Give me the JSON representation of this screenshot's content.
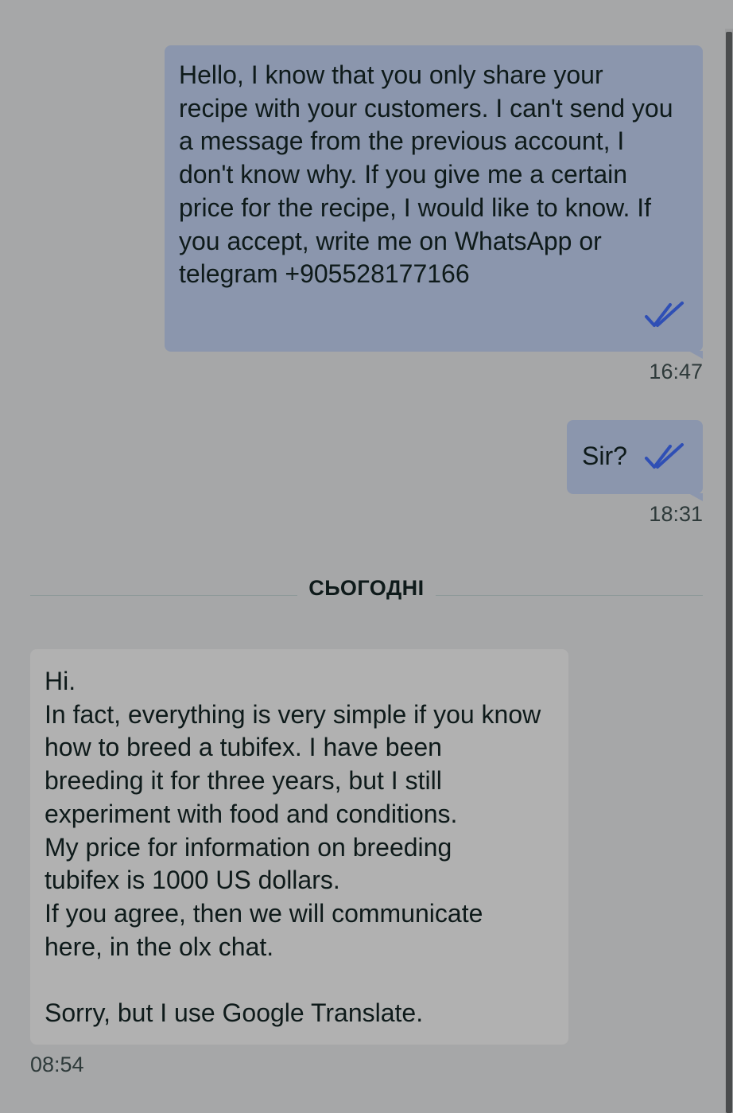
{
  "messages": [
    {
      "direction": "outgoing",
      "text": "Hello, I know that you only share your\nrecipe with your customers. I can't send you\na message from the previous account, I\ndon't know why. If you give me a certain\nprice for the recipe, I would like to know. If\nyou accept, write me on WhatsApp or\ntelegram +905528177166",
      "time": "16:47",
      "status_icon": "double-check-read"
    },
    {
      "direction": "outgoing",
      "text": "Sir?",
      "time": "18:31",
      "status_icon": "double-check-read"
    },
    {
      "direction": "incoming",
      "text": "Hi.\nIn fact, everything is very simple if you know\nhow to breed a tubifex. I have been\nbreeding it for three years, but I still\nexperiment with food and conditions.\nMy price for information on breeding\ntubifex is 1000 US dollars.\nIf you agree, then we will communicate\nhere, in the olx chat.\n\nSorry, but I use Google Translate.",
      "time": "08:54"
    }
  ],
  "date_divider": "СЬОГОДНІ",
  "colors": {
    "background": "#a6a7a8",
    "outgoing_bubble": "#8b96ad",
    "incoming_bubble": "#b1b1b1",
    "read_ticks": "#2f4fb5"
  }
}
